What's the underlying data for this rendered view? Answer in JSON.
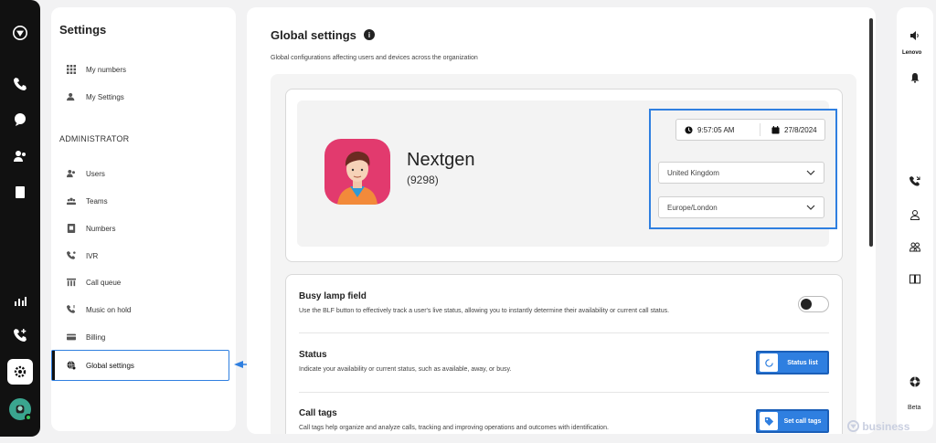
{
  "menu": {
    "title": "Settings",
    "personal": [
      {
        "label": "My numbers",
        "icon": "grid-icon"
      },
      {
        "label": "My Settings",
        "icon": "user-gear-icon"
      }
    ],
    "admin_section": "ADMINISTRATOR",
    "admin": [
      {
        "label": "Users",
        "icon": "users-icon"
      },
      {
        "label": "Teams",
        "icon": "team-icon"
      },
      {
        "label": "Numbers",
        "icon": "numbers-icon"
      },
      {
        "label": "IVR",
        "icon": "ivr-icon"
      },
      {
        "label": "Call queue",
        "icon": "call-queue-icon"
      },
      {
        "label": "Music on hold",
        "icon": "music-on-hold-icon"
      },
      {
        "label": "Billing",
        "icon": "credit-card-icon"
      },
      {
        "label": "Global settings",
        "icon": "globe-gear-icon",
        "active": true
      }
    ]
  },
  "main": {
    "title": "Global settings",
    "info": "i",
    "subtitle": "Global configurations affecting users and devices across the organization",
    "profile": {
      "name": "Nextgen",
      "extension": "(9298)",
      "time": "9:57:05 AM",
      "date": "27/8/2024",
      "country": "United Kingdom",
      "timezone": "Europe/London"
    },
    "settings": [
      {
        "title": "Busy lamp field",
        "desc": "Use the BLF button to effectively track a user's live status, allowing you to instantly determine their availability or current call status.",
        "control": "toggle",
        "enabled": false
      },
      {
        "title": "Status",
        "desc": "Indicate your availability or current status, such as available, away, or busy.",
        "control": "button",
        "button": "Status list"
      },
      {
        "title": "Call tags",
        "desc": "Call tags help organize and analyze calls, tracking and improving operations and outcomes with identification.",
        "control": "button",
        "button": "Set call tags"
      }
    ]
  },
  "right_rail": {
    "device_label": "Lenovo",
    "beta_label": "Beta"
  },
  "watermark": "business",
  "colors": {
    "accent": "#2f7fe0",
    "avatar_bg": "#e23a6e",
    "rail": "#111111"
  }
}
